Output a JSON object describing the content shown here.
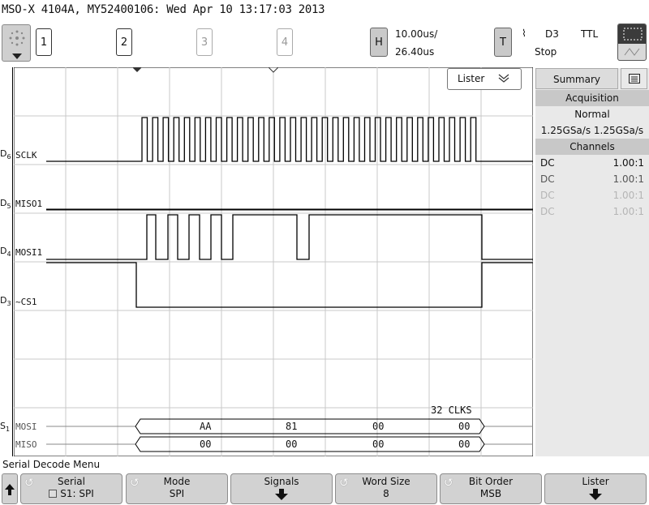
{
  "header": {
    "title": "MSO-X 4104A, MY52400106: Wed Apr 10 13:17:03 2013",
    "channels": [
      "1",
      "2",
      "3",
      "4"
    ],
    "h_label": "H",
    "time_div": "10.00us/",
    "time_delay": "26.40us",
    "t_label": "T",
    "trig_source": "D3",
    "trig_level": "TTL",
    "trig_mode": "Stop",
    "slope_symbol": "⌇"
  },
  "lister": {
    "label": "Lister"
  },
  "panel": {
    "summary_tab": "Summary",
    "acquisition_header": "Acquisition",
    "acq_mode": "Normal",
    "sample_rate": "1.25GSa/s 1.25GSa/s",
    "channels_header": "Channels",
    "channel_rows": [
      {
        "coupling": "DC",
        "probe": "1.00:1"
      },
      {
        "coupling": "DC",
        "probe": "1.00:1"
      },
      {
        "coupling": "DC",
        "probe": "1.00:1"
      },
      {
        "coupling": "DC",
        "probe": "1.00:1"
      }
    ]
  },
  "traces": {
    "d6_name": "D",
    "d6_sub": "6",
    "d6_label": "SCLK",
    "d5_name": "D",
    "d5_sub": "5",
    "d5_label": "MISO1",
    "d4_name": "D",
    "d4_sub": "4",
    "d4_label": "MOSI1",
    "d3_name": "D",
    "d3_sub": "3",
    "d3_label": "~CS1",
    "s1_name": "S",
    "s1_sub": "1",
    "mosi_label": "MOSI",
    "miso_label": "MISO",
    "clk_count": "32 CLKS",
    "mosi_bytes": [
      "AA",
      "81",
      "00",
      "00"
    ],
    "miso_bytes": [
      "00",
      "00",
      "00",
      "00"
    ]
  },
  "menu": {
    "title": "Serial Decode Menu",
    "softkeys": [
      {
        "label": "Serial",
        "value": "S1: SPI"
      },
      {
        "label": "Mode",
        "value": "SPI"
      },
      {
        "label": "Signals",
        "value": ""
      },
      {
        "label": "Word Size",
        "value": "8"
      },
      {
        "label": "Bit Order",
        "value": "MSB"
      },
      {
        "label": "Lister",
        "value": ""
      }
    ]
  }
}
